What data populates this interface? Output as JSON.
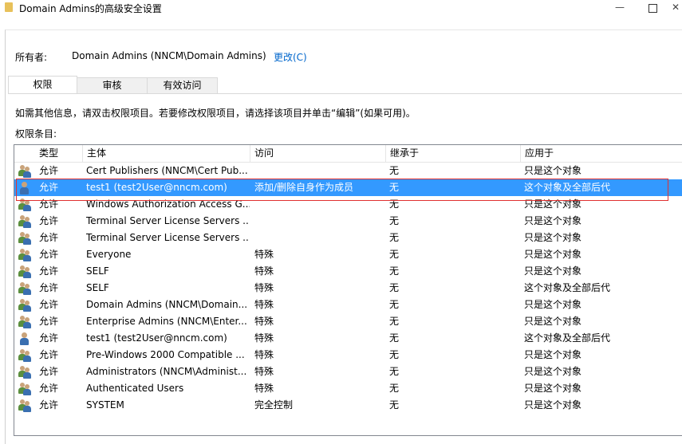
{
  "window": {
    "title": "Domain Admins的高级安全设置",
    "min_glyph": "—",
    "close_glyph": "✕"
  },
  "owner": {
    "label": "所有者:",
    "value": "Domain Admins (NNCM\\Domain Admins)",
    "change_link": "更改(C)"
  },
  "tabs": [
    {
      "label": "权限",
      "active": true
    },
    {
      "label": "审核",
      "active": false
    },
    {
      "label": "有效访问",
      "active": false
    }
  ],
  "info_text": "如需其他信息，请双击权限项目。若要修改权限项目，请选择该项目并单击“编辑”(如果可用)。",
  "entries_label": "权限条目:",
  "columns": {
    "type": "类型",
    "principal": "主体",
    "access": "访问",
    "inherited": "继承于",
    "applies_to": "应用于"
  },
  "rows": [
    {
      "icon": "group-icon",
      "type": "允许",
      "principal": "Cert Publishers (NNCM\\Cert Pub...",
      "access": "",
      "inherited": "无",
      "applies_to": "只是这个对象"
    },
    {
      "icon": "user-icon",
      "type": "允许",
      "principal": "test1 (test2User@nncm.com)",
      "access": "添加/删除自身作为成员",
      "inherited": "无",
      "applies_to": "这个对象及全部后代",
      "selected": true
    },
    {
      "icon": "group-icon",
      "type": "允许",
      "principal": "Windows Authorization Access G...",
      "access": "",
      "inherited": "无",
      "applies_to": "只是这个对象"
    },
    {
      "icon": "group-icon",
      "type": "允许",
      "principal": "Terminal Server License Servers ...",
      "access": "",
      "inherited": "无",
      "applies_to": "只是这个对象"
    },
    {
      "icon": "group-icon",
      "type": "允许",
      "principal": "Terminal Server License Servers ...",
      "access": "",
      "inherited": "无",
      "applies_to": "只是这个对象"
    },
    {
      "icon": "group-icon",
      "type": "允许",
      "principal": "Everyone",
      "access": "特殊",
      "inherited": "无",
      "applies_to": "只是这个对象"
    },
    {
      "icon": "group-icon",
      "type": "允许",
      "principal": "SELF",
      "access": "特殊",
      "inherited": "无",
      "applies_to": "只是这个对象"
    },
    {
      "icon": "group-icon",
      "type": "允许",
      "principal": "SELF",
      "access": "特殊",
      "inherited": "无",
      "applies_to": "这个对象及全部后代"
    },
    {
      "icon": "group-icon",
      "type": "允许",
      "principal": "Domain Admins (NNCM\\Domain...",
      "access": "特殊",
      "inherited": "无",
      "applies_to": "只是这个对象"
    },
    {
      "icon": "group-icon",
      "type": "允许",
      "principal": "Enterprise Admins (NNCM\\Enter...",
      "access": "特殊",
      "inherited": "无",
      "applies_to": "只是这个对象"
    },
    {
      "icon": "user-icon",
      "type": "允许",
      "principal": "test1 (test2User@nncm.com)",
      "access": "特殊",
      "inherited": "无",
      "applies_to": "这个对象及全部后代"
    },
    {
      "icon": "group-icon",
      "type": "允许",
      "principal": "Pre-Windows 2000 Compatible ...",
      "access": "特殊",
      "inherited": "无",
      "applies_to": "只是这个对象"
    },
    {
      "icon": "group-icon",
      "type": "允许",
      "principal": "Administrators (NNCM\\Administ...",
      "access": "特殊",
      "inherited": "无",
      "applies_to": "只是这个对象"
    },
    {
      "icon": "group-icon",
      "type": "允许",
      "principal": "Authenticated Users",
      "access": "特殊",
      "inherited": "无",
      "applies_to": "只是这个对象"
    },
    {
      "icon": "group-icon",
      "type": "允许",
      "principal": "SYSTEM",
      "access": "完全控制",
      "inherited": "无",
      "applies_to": "只是这个对象"
    }
  ],
  "colors": {
    "selection": "#3399ff",
    "link": "#0066cc",
    "highlight_border": "#e03030"
  }
}
